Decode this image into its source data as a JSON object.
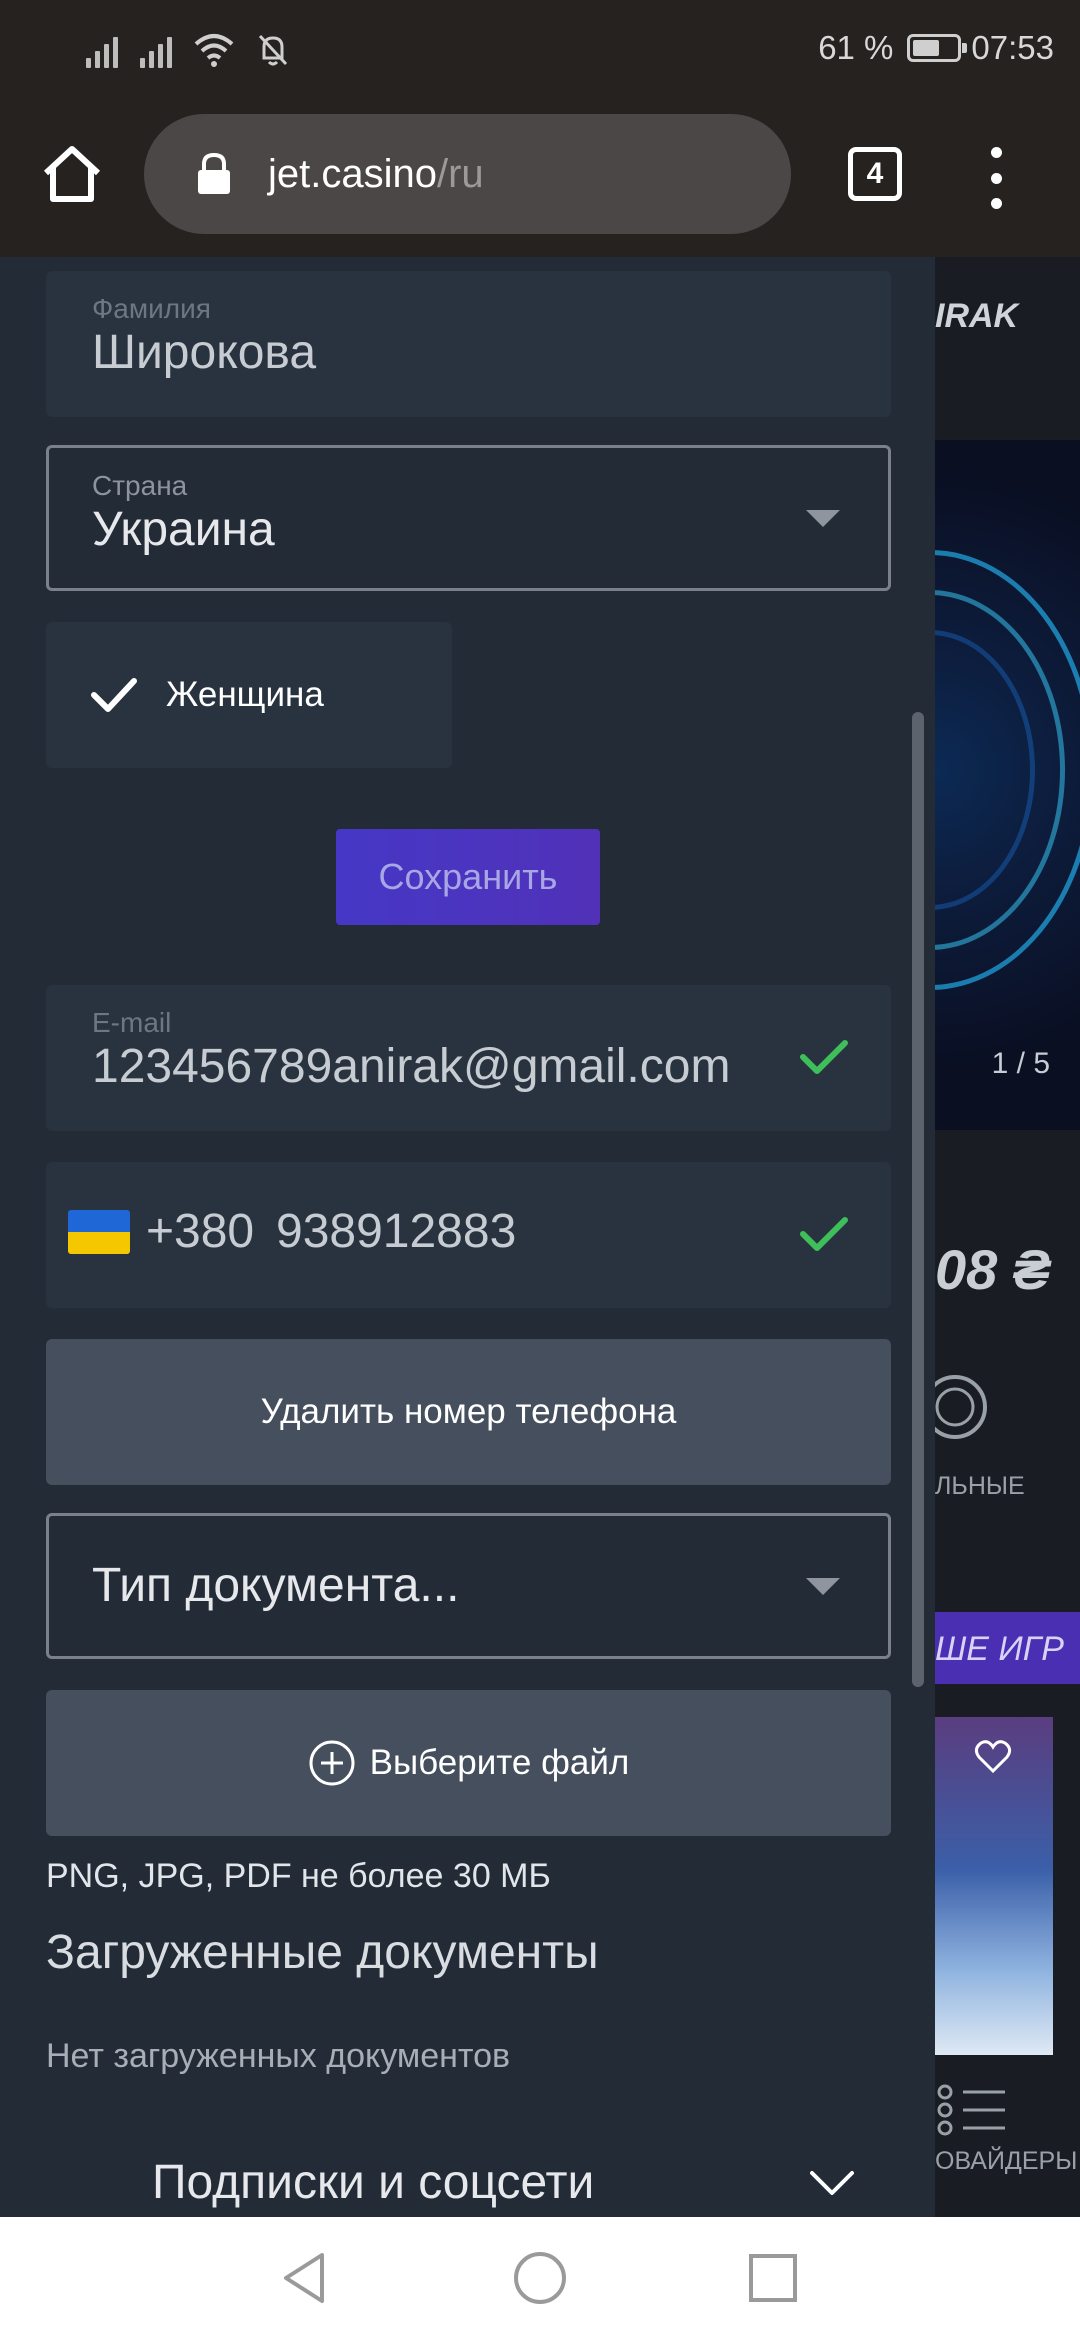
{
  "status_bar": {
    "battery_percent": "61 %",
    "time": "07:53",
    "battery_level": 0.61
  },
  "browser": {
    "url_host": "jet.casino",
    "url_path": "/ru",
    "tab_count": "4"
  },
  "form": {
    "surname": {
      "label": "Фамилия",
      "value": "Широкова"
    },
    "country": {
      "label": "Страна",
      "value": "Украина"
    },
    "gender": {
      "label": "Женщина",
      "checked": true
    },
    "save_label": "Сохранить",
    "email": {
      "label": "E-mail",
      "value": "123456789anirak@gmail.com",
      "verified": true
    },
    "phone": {
      "code": "+380",
      "number": "938912883",
      "verified": true
    },
    "delete_phone_label": "Удалить номер телефона",
    "document_type_placeholder": "Тип документа...",
    "choose_file_label": "Выберите файл",
    "file_hint": "PNG, JPG, PDF не более 30 МБ",
    "uploaded_title": "Загруженные документы",
    "no_documents": "Нет загруженных документов",
    "subscriptions_label": "Подписки и соцсети"
  },
  "background_page": {
    "brand_fragment": "IRAK",
    "slide_counter": "1 / 5",
    "amount_fragment": "08 ₴",
    "category_fragment": "ЛЬНЫЕ",
    "games_fragment": "ШЕ ИГР",
    "providers_fragment": "ОВАЙДЕРЫ"
  },
  "colors": {
    "accent_purple": "#4538c6",
    "verified_green": "#3fbf5a",
    "panel_bg": "#222b36",
    "field_bg": "#29333f"
  }
}
